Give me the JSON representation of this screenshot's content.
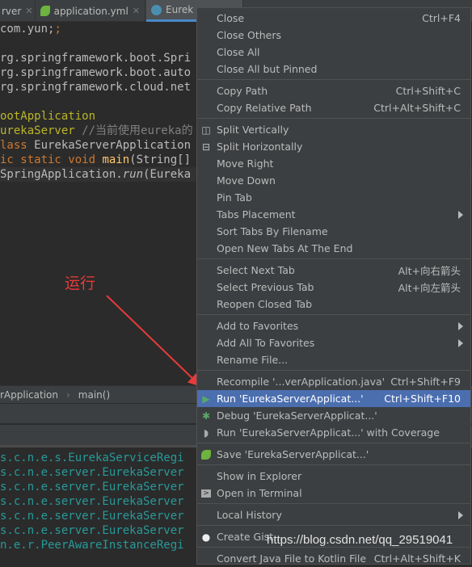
{
  "tabs": [
    {
      "label": "rver",
      "active": false
    },
    {
      "label": "application.yml",
      "active": false
    },
    {
      "label": "Eurek",
      "active": true
    }
  ],
  "code": {
    "l1": "com.yun;",
    "l2": "rg.springframework.boot.Spri",
    "l3": "rg.springframework.boot.auto",
    "l4": "rg.springframework.cloud.net",
    "l5": "ootApplication",
    "l6a": "urekaServer ",
    "l6b": "//当前使用eureka的",
    "l7a": "lass ",
    "l7b": "EurekaServerApplication",
    "l8a": "ic static void ",
    "l8b": "main",
    "l8c": "(String[]",
    "l9a": "SpringApplication.",
    "l9b": "run",
    "l9c": "(Eureka"
  },
  "breadcrumb": [
    "rApplication",
    "main()"
  ],
  "console": [
    "s.c.n.e.s.EurekaServiceRegi",
    "s.c.n.e.server.EurekaServer",
    "s.c.n.e.server.EurekaServer",
    "s.c.n.e.server.EurekaServer",
    "s.c.n.e.server.EurekaServer",
    "s.c.n.e.server.EurekaServer",
    "n.e.r.PeerAwareInstanceRegi"
  ],
  "annotation": "运行",
  "watermark": "https://blog.csdn.net/qq_29519041",
  "menu": [
    {
      "label": "Close",
      "shortcut": "Ctrl+F4"
    },
    {
      "label": "Close Others"
    },
    {
      "label": "Close All"
    },
    {
      "label": "Close All but Pinned"
    },
    {
      "sep": true
    },
    {
      "label": "Copy Path",
      "shortcut": "Ctrl+Shift+C"
    },
    {
      "label": "Copy Relative Path",
      "shortcut": "Ctrl+Alt+Shift+C"
    },
    {
      "sep": true
    },
    {
      "label": "Split Vertically",
      "icon": "split-vertical-icon"
    },
    {
      "label": "Split Horizontally",
      "icon": "split-horizontal-icon"
    },
    {
      "label": "Move Right"
    },
    {
      "label": "Move Down"
    },
    {
      "label": "Pin Tab"
    },
    {
      "label": "Tabs Placement",
      "submenu": true
    },
    {
      "label": "Sort Tabs By Filename"
    },
    {
      "label": "Open New Tabs At The End"
    },
    {
      "sep": true
    },
    {
      "label": "Select Next Tab",
      "shortcut": "Alt+向右箭头"
    },
    {
      "label": "Select Previous Tab",
      "shortcut": "Alt+向左箭头"
    },
    {
      "label": "Reopen Closed Tab"
    },
    {
      "sep": true
    },
    {
      "label": "Add to Favorites",
      "submenu": true
    },
    {
      "label": "Add All To Favorites",
      "submenu": true
    },
    {
      "label": "Rename File..."
    },
    {
      "sep": true
    },
    {
      "label": "Recompile '...verApplication.java'",
      "shortcut": "Ctrl+Shift+F9"
    },
    {
      "label": "Run 'EurekaServerApplicat...'",
      "shortcut": "Ctrl+Shift+F10",
      "icon": "run-icon",
      "highlighted": true
    },
    {
      "label": "Debug 'EurekaServerApplicat...'",
      "icon": "debug-icon"
    },
    {
      "label": "Run 'EurekaServerApplicat...' with Coverage",
      "icon": "coverage-icon"
    },
    {
      "sep": true
    },
    {
      "label": "Save 'EurekaServerApplicat...'",
      "icon": "spring-boot-icon"
    },
    {
      "sep": true
    },
    {
      "label": "Show in Explorer"
    },
    {
      "label": "Open in Terminal",
      "icon": "terminal-icon"
    },
    {
      "sep": true
    },
    {
      "label": "Local History",
      "submenu": true
    },
    {
      "sep": true
    },
    {
      "label": "Create Gist...",
      "icon": "github-icon"
    },
    {
      "sep": true
    },
    {
      "label": "Convert Java File to Kotlin File",
      "shortcut": "Ctrl+Alt+Shift+K"
    }
  ],
  "colors": {
    "highlight": "#4b6eaf",
    "annotation": "#e83a3a",
    "menu_bg": "#3c3f41"
  }
}
